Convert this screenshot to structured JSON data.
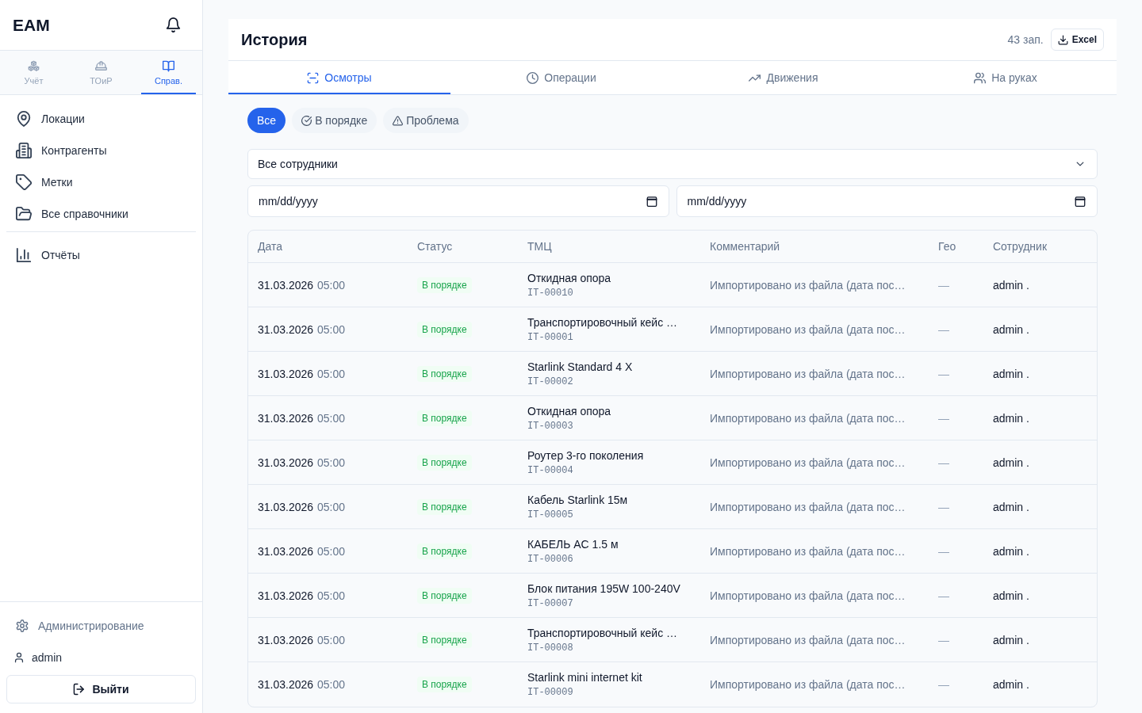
{
  "sidebar": {
    "logo": "EAM",
    "sections": [
      {
        "label": "Учёт",
        "selected": false
      },
      {
        "label": "ТОиР",
        "selected": false
      },
      {
        "label": "Справ.",
        "selected": true
      }
    ],
    "nav_groups": [
      {
        "items": [
          {
            "label": "Локации",
            "selected": false
          },
          {
            "label": "Контрагенты",
            "selected": false
          },
          {
            "label": "Метки",
            "selected": false
          },
          {
            "label": "Все справочники",
            "selected": false
          }
        ]
      },
      {
        "items": [
          {
            "label": "Отчёты",
            "selected": false
          }
        ]
      }
    ],
    "admin_link": "Администрирование",
    "user": "admin",
    "logout_button": "Выйти"
  },
  "history": {
    "title": "История",
    "record_count": "43 зап.",
    "export_button": "Excel",
    "tabs": [
      {
        "label": "Осмотры",
        "selected": true
      },
      {
        "label": "Операции",
        "selected": false
      },
      {
        "label": "Движения",
        "selected": false
      },
      {
        "label": "На руках",
        "selected": false
      }
    ],
    "status_filters": [
      {
        "label": "Все",
        "selected": true
      },
      {
        "label": "В порядке",
        "selected": false
      },
      {
        "label": "Проблема",
        "selected": false
      }
    ],
    "employee_filter": {
      "value": "Все сотрудники"
    },
    "date_from": {
      "placeholder": "mm/dd/yyyy"
    },
    "date_to": {
      "placeholder": "mm/dd/yyyy"
    },
    "table": {
      "columns": [
        "Дата",
        "Статус",
        "ТМЦ",
        "Комментарий",
        "Гео",
        "Сотрудник"
      ],
      "rows": [
        {
          "date": "31.03.2026",
          "time": "05:00",
          "status": {
            "label": "В порядке",
            "kind": "ok"
          },
          "item": "Откидная опора",
          "code": "IT-00010",
          "comment": "Импортировано из файла (дата пос…",
          "geo": "—",
          "employee": "admin ."
        },
        {
          "date": "31.03.2026",
          "time": "05:00",
          "status": {
            "label": "В порядке",
            "kind": "ok"
          },
          "item": "Транспортировочный кейс …",
          "code": "IT-00001",
          "comment": "Импортировано из файла (дата пос…",
          "geo": "—",
          "employee": "admin ."
        },
        {
          "date": "31.03.2026",
          "time": "05:00",
          "status": {
            "label": "В порядке",
            "kind": "ok"
          },
          "item": "Starlink Standard 4 X",
          "code": "IT-00002",
          "comment": "Импортировано из файла (дата пос…",
          "geo": "—",
          "employee": "admin ."
        },
        {
          "date": "31.03.2026",
          "time": "05:00",
          "status": {
            "label": "В порядке",
            "kind": "ok"
          },
          "item": "Откидная опора",
          "code": "IT-00003",
          "comment": "Импортировано из файла (дата пос…",
          "geo": "—",
          "employee": "admin ."
        },
        {
          "date": "31.03.2026",
          "time": "05:00",
          "status": {
            "label": "В порядке",
            "kind": "ok"
          },
          "item": "Роутер 3-го поколения",
          "code": "IT-00004",
          "comment": "Импортировано из файла (дата пос…",
          "geo": "—",
          "employee": "admin ."
        },
        {
          "date": "31.03.2026",
          "time": "05:00",
          "status": {
            "label": "В порядке",
            "kind": "ok"
          },
          "item": "Кабель Starlink 15м",
          "code": "IT-00005",
          "comment": "Импортировано из файла (дата пос…",
          "geo": "—",
          "employee": "admin ."
        },
        {
          "date": "31.03.2026",
          "time": "05:00",
          "status": {
            "label": "В порядке",
            "kind": "ok"
          },
          "item": "КАБЕЛЬ AC 1.5 м",
          "code": "IT-00006",
          "comment": "Импортировано из файла (дата пос…",
          "geo": "—",
          "employee": "admin ."
        },
        {
          "date": "31.03.2026",
          "time": "05:00",
          "status": {
            "label": "В порядке",
            "kind": "ok"
          },
          "item": "Блок питания 195W 100-240V",
          "code": "IT-00007",
          "comment": "Импортировано из файла (дата пос…",
          "geo": "—",
          "employee": "admin ."
        },
        {
          "date": "31.03.2026",
          "time": "05:00",
          "status": {
            "label": "В порядке",
            "kind": "ok"
          },
          "item": "Транспортировочный кейс …",
          "code": "IT-00008",
          "comment": "Импортировано из файла (дата пос…",
          "geo": "—",
          "employee": "admin ."
        },
        {
          "date": "31.03.2026",
          "time": "05:00",
          "status": {
            "label": "В порядке",
            "kind": "ok"
          },
          "item": "Starlink mini internet kit",
          "code": "IT-00009",
          "comment": "Импортировано из файла (дата пос…",
          "geo": "—",
          "employee": "admin ."
        }
      ]
    }
  }
}
